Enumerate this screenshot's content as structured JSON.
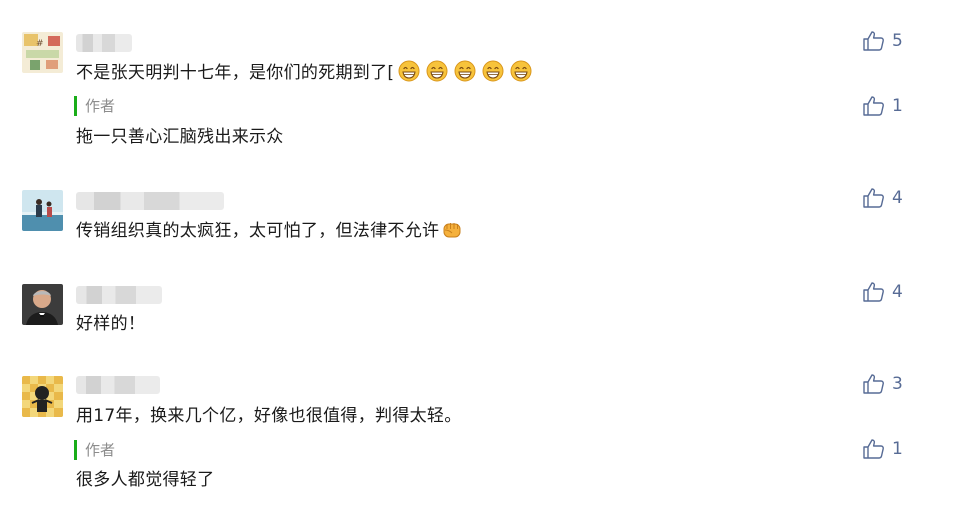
{
  "comments": [
    {
      "text": "不是张天明判十七年，是你们的死期到了[",
      "likes": "5",
      "emoji_count": 5,
      "reply": {
        "tag": "作者",
        "text": "拖一只善心汇脑残出来示众",
        "likes": "1"
      }
    },
    {
      "text": "传销组织真的太疯狂，太可怕了，但法律不允许",
      "likes": "4"
    },
    {
      "text": "好样的！",
      "likes": "4"
    },
    {
      "text": "用17年，换来几个亿，好像也很值得，判得太轻。",
      "likes": "3",
      "reply": {
        "tag": "作者",
        "text": "很多人都觉得轻了",
        "likes": "1"
      }
    }
  ],
  "colors": {
    "like_blue": "#576b95",
    "author_green": "#1aad19"
  },
  "icons": {
    "like": "thumbs-up-icon",
    "grin_emoji": "grin-emoji-icon",
    "fist_emoji": "fist-emoji-icon"
  }
}
